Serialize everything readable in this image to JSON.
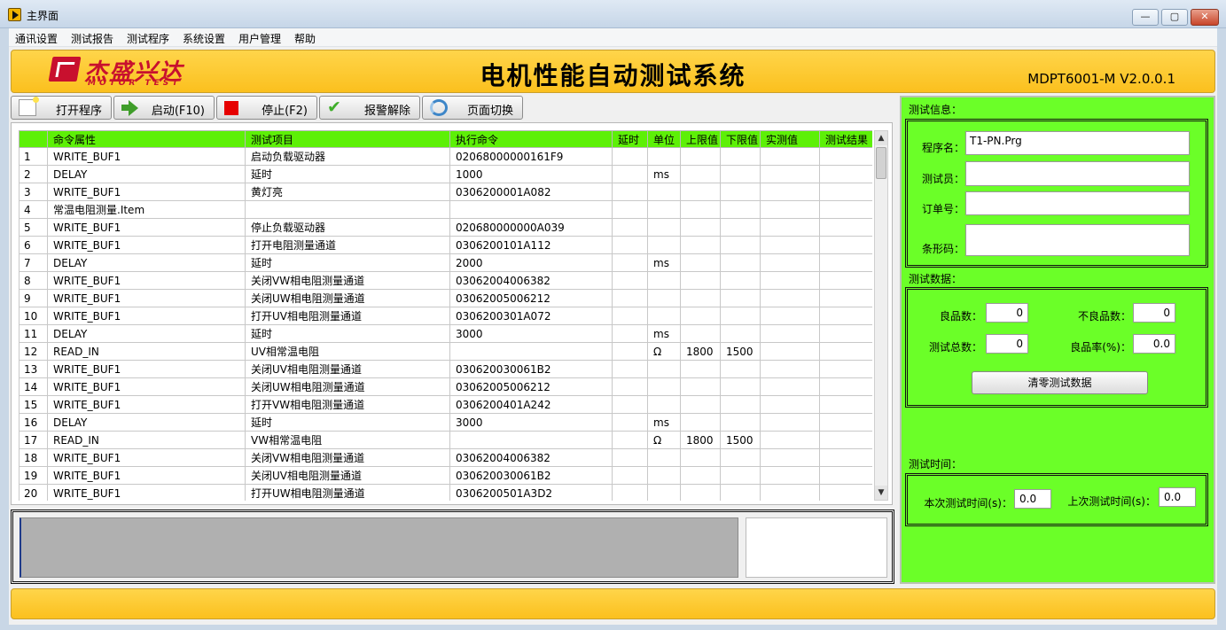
{
  "window": {
    "title": "主界面",
    "minimize": "—",
    "maximize": "▢",
    "close": "✕"
  },
  "menu": [
    "通讯设置",
    "测试报告",
    "测试程序",
    "系统设置",
    "用户管理",
    "帮助"
  ],
  "header": {
    "logo_cn": "杰盛兴达",
    "logo_en": "MOTOR TEST",
    "title": "电机性能自动测试系统",
    "version": "MDPT6001-M V2.0.0.1"
  },
  "toolbar": {
    "open": "打开程序",
    "start": "启动(F10)",
    "stop": "停止(F2)",
    "alarm_clear": "报警解除",
    "page_switch": "页面切换"
  },
  "table": {
    "columns": [
      "",
      "命令属性",
      "测试项目",
      "执行命令",
      "延时",
      "单位",
      "上限值",
      "下限值",
      "实测值",
      "测试结果"
    ],
    "rows": [
      [
        "1",
        "WRITE_BUF1",
        "启动负载驱动器",
        "02068000000161F9",
        "",
        "",
        "",
        "",
        "",
        ""
      ],
      [
        "2",
        "DELAY",
        "延时",
        "1000",
        "",
        "ms",
        "",
        "",
        "",
        ""
      ],
      [
        "3",
        "WRITE_BUF1",
        "黄灯亮",
        "0306200001A082",
        "",
        "",
        "",
        "",
        "",
        ""
      ],
      [
        "4",
        "常温电阻测量.Item",
        "",
        "",
        "",
        "",
        "",
        "",
        "",
        ""
      ],
      [
        "5",
        "WRITE_BUF1",
        "停止负载驱动器",
        "020680000000A039",
        "",
        "",
        "",
        "",
        "",
        ""
      ],
      [
        "6",
        "WRITE_BUF1",
        "打开电阻测量通道",
        "0306200101A112",
        "",
        "",
        "",
        "",
        "",
        ""
      ],
      [
        "7",
        "DELAY",
        "延时",
        "2000",
        "",
        "ms",
        "",
        "",
        "",
        ""
      ],
      [
        "8",
        "WRITE_BUF1",
        "关闭VW相电阻测量通道",
        "03062004006382",
        "",
        "",
        "",
        "",
        "",
        ""
      ],
      [
        "9",
        "WRITE_BUF1",
        "关闭UW相电阻测量通道",
        "03062005006212",
        "",
        "",
        "",
        "",
        "",
        ""
      ],
      [
        "10",
        "WRITE_BUF1",
        "打开UV相电阻测量通道",
        "0306200301A072",
        "",
        "",
        "",
        "",
        "",
        ""
      ],
      [
        "11",
        "DELAY",
        "延时",
        "3000",
        "",
        "ms",
        "",
        "",
        "",
        ""
      ],
      [
        "12",
        "READ_IN",
        "UV相常温电阻",
        "",
        "",
        "Ω",
        "1800",
        "1500",
        "",
        ""
      ],
      [
        "13",
        "WRITE_BUF1",
        "关闭UV相电阻测量通道",
        "030620030061B2",
        "",
        "",
        "",
        "",
        "",
        ""
      ],
      [
        "14",
        "WRITE_BUF1",
        "关闭UW相电阻测量通道",
        "03062005006212",
        "",
        "",
        "",
        "",
        "",
        ""
      ],
      [
        "15",
        "WRITE_BUF1",
        "打开VW相电阻测量通道",
        "0306200401A242",
        "",
        "",
        "",
        "",
        "",
        ""
      ],
      [
        "16",
        "DELAY",
        "延时",
        "3000",
        "",
        "ms",
        "",
        "",
        "",
        ""
      ],
      [
        "17",
        "READ_IN",
        "VW相常温电阻",
        "",
        "",
        "Ω",
        "1800",
        "1500",
        "",
        ""
      ],
      [
        "18",
        "WRITE_BUF1",
        "关闭VW相电阻测量通道",
        "03062004006382",
        "",
        "",
        "",
        "",
        "",
        ""
      ],
      [
        "19",
        "WRITE_BUF1",
        "关闭UV相电阻测量通道",
        "030620030061B2",
        "",
        "",
        "",
        "",
        "",
        ""
      ],
      [
        "20",
        "WRITE_BUF1",
        "打开UW相电阻测量通道",
        "0306200501A3D2",
        "",
        "",
        "",
        "",
        "",
        ""
      ]
    ]
  },
  "info": {
    "section_label": "测试信息：",
    "program_label": "程序名：",
    "program_value": "T1-PN.Prg",
    "tester_label": "测试员：",
    "tester_value": "",
    "order_label": "订单号：",
    "order_value": "",
    "barcode_label": "条形码：",
    "barcode_value": ""
  },
  "data": {
    "section_label": "测试数据：",
    "good_label": "良品数：",
    "good_value": "0",
    "bad_label": "不良品数：",
    "bad_value": "0",
    "total_label": "测试总数：",
    "total_value": "0",
    "rate_label": "良品率(%)：",
    "rate_value": "0.0",
    "clear_button": "清零测试数据"
  },
  "time": {
    "section_label": "测试时间：",
    "current_label": "本次测试时间(s)：",
    "current_value": "0.0",
    "last_label": "上次测试时间(s)：",
    "last_value": "0.0"
  },
  "colors": {
    "header_yellow": "#fbc01e",
    "table_header_green": "#5df007",
    "info_panel_green": "#6bff28",
    "stop_red": "#e60000"
  }
}
